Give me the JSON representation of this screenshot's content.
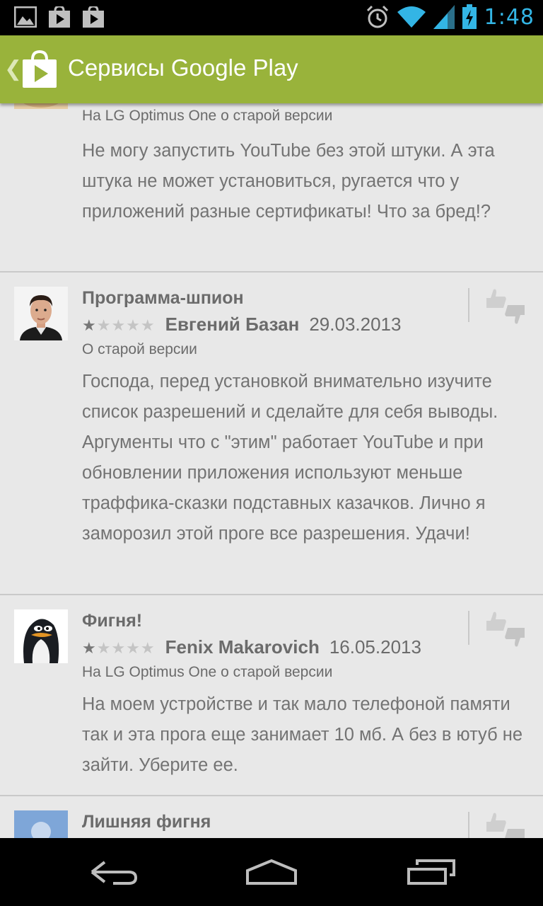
{
  "status_bar": {
    "time": "1:48",
    "icons": [
      "gallery-notification-icon",
      "play-store-notification-icon",
      "play-store-notification-icon-2",
      "alarm-icon",
      "wifi-icon",
      "signal-icon",
      "battery-charging-icon"
    ]
  },
  "action_bar": {
    "title": "Сервисы Google Play",
    "icon": "play-store-icon",
    "up_icon": "up-caret-icon"
  },
  "reviews": [
    {
      "title": "",
      "author": "",
      "date": "",
      "rating": null,
      "version_note": "На LG Optimus One о старой версии",
      "body": "Не могу запустить YouTube без этой штуки. А эта штука не может установиться, ругается что у приложений разные сертификаты! Что за бред!?"
    },
    {
      "title": "Программа-шпион",
      "author": "Евгений Базан",
      "date": "29.03.2013",
      "rating": 1,
      "version_note": "О старой версии",
      "body": "Господа, перед установкой внимательно изучите список разрешений и сделайте для себя выводы. Аргументы что с \"этим\" работает YouTube и при обновлении приложения используют меньше траффика-сказки подставных казачков. Лично я заморозил этой проге все разрешения. Удачи!"
    },
    {
      "title": "Фигня!",
      "author": "Fenix Makarovich",
      "date": "16.05.2013",
      "rating": 1,
      "version_note": "На LG Optimus One о старой версии",
      "body": "На моем устройстве и так мало телефоной памяти так и эта прога еще занимает 10 мб. А без в ютуб не зайти. Уберите ее."
    },
    {
      "title": "Лишняя фигня",
      "author": "",
      "date": "",
      "rating": null,
      "version_note": "",
      "body": ""
    }
  ],
  "stars_max": 5,
  "nav_bar": {
    "buttons": [
      "back-icon",
      "home-icon",
      "recent-apps-icon"
    ]
  },
  "colors": {
    "action_bar": "#99b33b",
    "background": "#e8e8e8",
    "status_accent": "#33b5e5"
  }
}
